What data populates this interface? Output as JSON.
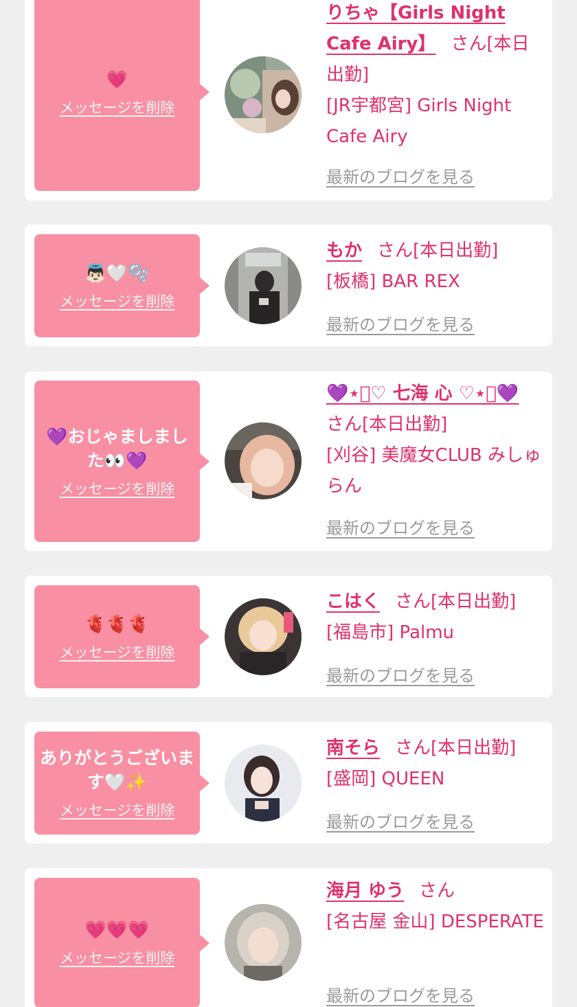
{
  "common": {
    "delete_label": "メッセージを削除",
    "blog_label": "最新のブログを見る",
    "san": "さん"
  },
  "cards": [
    {
      "message": "💗",
      "name": "りちゃ【Girls Night Cafe Airy】",
      "status": "[本日出勤]",
      "location": "[JR宇都宮] Girls Night Cafe Airy"
    },
    {
      "message": "👼🏻🤍🫧",
      "name": "もか",
      "status": "[本日出勤]",
      "location": "[板橋] BAR REX"
    },
    {
      "message": "💜おじゃましました👀💜",
      "name": "💜⋆͛♡ 七海 心 ♡⋆͛💜",
      "status": "[本日出勤]",
      "location": "[刈谷] 美魔女CLUB みしゅらん"
    },
    {
      "message": "🫀🫀🫀",
      "name": "こはく",
      "status": "[本日出勤]",
      "location": "[福島市] Palmu"
    },
    {
      "message": "ありがとうございます🤍✨",
      "name": "南そら",
      "status": "[本日出勤]",
      "location": "[盛岡] QUEEN"
    },
    {
      "message": "💗💗💗",
      "name": "海月 ゆう",
      "status": "",
      "location": "[名古屋 金山] DESPERATE"
    }
  ],
  "colors": {
    "page_bg": "#efefef",
    "card_bg": "#ffffff",
    "bubble_bg": "#f88fa3",
    "accent": "#e0306a",
    "muted": "#9a9a9a"
  }
}
